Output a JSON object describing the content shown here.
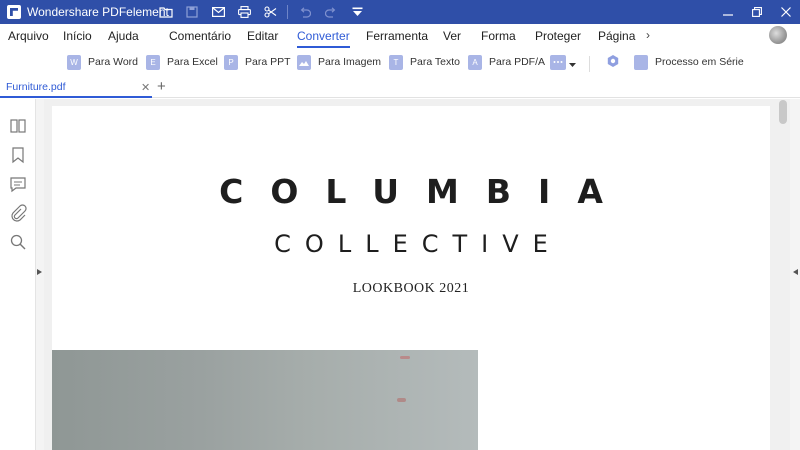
{
  "app": {
    "title": "Wondershare PDFelement"
  },
  "menu": {
    "items": [
      "Arquivo",
      "Início",
      "Ajuda",
      "Comentário",
      "Editar",
      "Converter",
      "Ferramenta",
      "Ver",
      "Forma",
      "Proteger",
      "Página"
    ],
    "active": "Converter",
    "more_glyph": "›"
  },
  "toolbar": {
    "tools": [
      "Para Word",
      "Para Excel",
      "Para PPT",
      "Para Imagem",
      "Para Texto",
      "Para PDF/A",
      "",
      "Processo em Série"
    ],
    "icon_letters": [
      "W",
      "E",
      "P",
      "",
      "T",
      "A"
    ]
  },
  "tab": {
    "label": "Furniture.pdf",
    "close_glyph": "✕",
    "add_glyph": "+"
  },
  "document": {
    "title": "COLUMBIA",
    "subtitle": "COLLECTIVE",
    "line3": "LOOKBOOK 2021"
  },
  "colors": {
    "titlebar": "#2F4FA8",
    "accent": "#2F5BD6",
    "tool_icon": "#A9B5E6"
  },
  "icons": {
    "titlebar": [
      "folder-icon",
      "save-icon",
      "mail-icon",
      "print-icon",
      "scissors-icon",
      "undo-icon",
      "redo-icon",
      "dropdown-icon"
    ],
    "leftrail": [
      "thumbnails-icon",
      "bookmark-icon",
      "comment-icon",
      "attachment-icon",
      "search-icon"
    ]
  }
}
